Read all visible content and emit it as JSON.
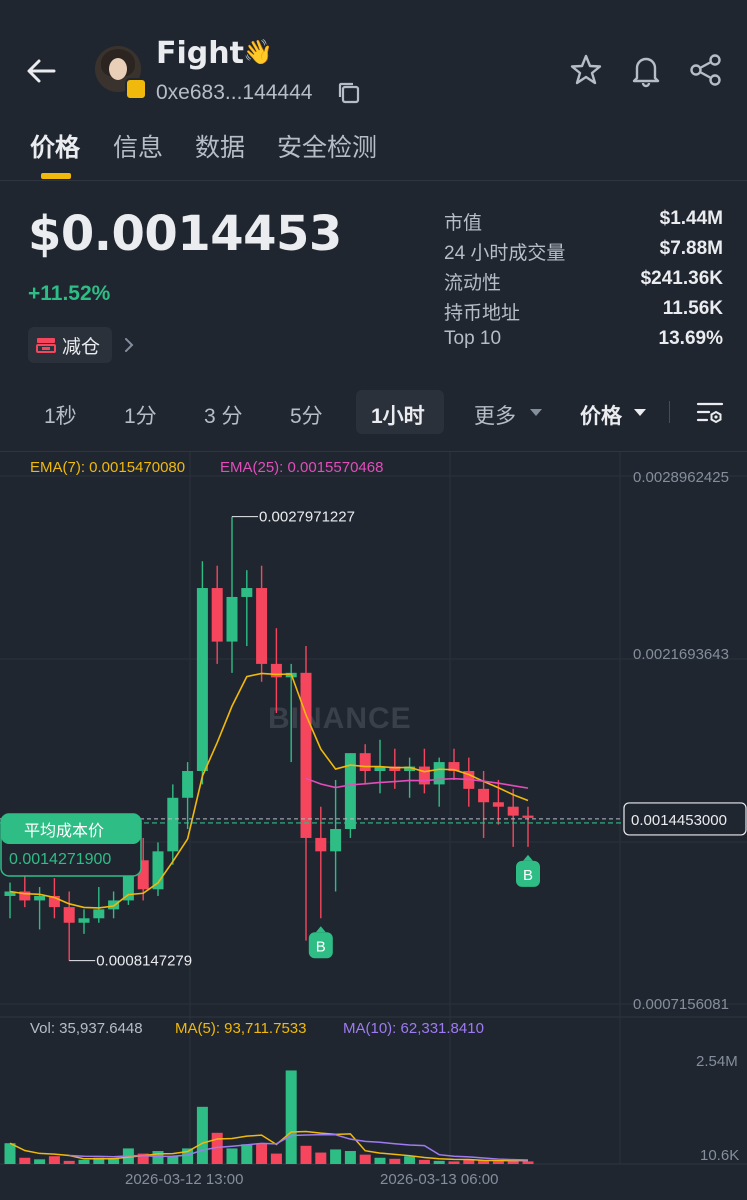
{
  "header": {
    "token_name": "Fight",
    "token_emoji": "👋",
    "address": "0xe683...144444"
  },
  "tabs": [
    {
      "label": "价格",
      "active": true
    },
    {
      "label": "信息",
      "active": false
    },
    {
      "label": "数据",
      "active": false
    },
    {
      "label": "安全检测",
      "active": false
    }
  ],
  "price": {
    "value": "$0.0014453",
    "change": "+11.52%",
    "reduce_label": "减仓"
  },
  "stats": [
    {
      "label": "市值",
      "value": "$1.44M"
    },
    {
      "label": "24 小时成交量",
      "value": "$7.88M"
    },
    {
      "label": "流动性",
      "value": "$241.36K"
    },
    {
      "label": "持币地址",
      "value": "11.56K"
    },
    {
      "label": "Top 10",
      "value": "13.69%"
    }
  ],
  "intervals": [
    {
      "label": "1秒",
      "active": false
    },
    {
      "label": "1分",
      "active": false
    },
    {
      "label": "3 分",
      "active": false
    },
    {
      "label": "5分",
      "active": false
    },
    {
      "label": "1小时",
      "active": true
    },
    {
      "label": "更多",
      "active": false
    }
  ],
  "price_selector": "价格",
  "indicators": {
    "ema7": "EMA(7): 0.0015470080",
    "ema25": "EMA(25): 0.0015570468",
    "vol": "Vol: 35,937.6448",
    "ma5": "MA(5): 93,711.7533",
    "ma10": "MA(10): 62,331.8410"
  },
  "colors": {
    "up": "#2ebd85",
    "down": "#f6465d",
    "ema7": "#f0b90b",
    "ema25": "#e24dba",
    "ma10": "#9d7bf0",
    "accent": "#f0b90b"
  },
  "chart_data": {
    "type": "candlestick",
    "price_axis_labels": [
      "0.0028962425",
      "0.0021693643",
      "0.0014453000",
      "0.0007156081"
    ],
    "volume_axis_labels": [
      "2.54M",
      "10.6K"
    ],
    "x_labels": [
      "2026-03-12 13:00",
      "2026-03-13 06:00"
    ],
    "high_annotation": "0.0027971227",
    "low_annotation": "0.0008147279",
    "current_price_label": "0.0014453000",
    "avg_cost_title": "平均成本价",
    "avg_cost_value": "0.0014271900",
    "avg_cost": 0.00142719,
    "current_price": 0.0014453,
    "watermark": "BINANCE",
    "buy_markers": [
      "B",
      "B"
    ],
    "buy_marker_indices": [
      21,
      35
    ],
    "y_range": [
      0.00058,
      0.003
    ],
    "volume_range": [
      0,
      2540000
    ],
    "candles": [
      {
        "o": 0.0011,
        "h": 0.00116,
        "l": 0.001,
        "c": 0.00112
      },
      {
        "o": 0.00112,
        "h": 0.00122,
        "l": 0.00105,
        "c": 0.00108
      },
      {
        "o": 0.00108,
        "h": 0.00114,
        "l": 0.00095,
        "c": 0.0011
      },
      {
        "o": 0.0011,
        "h": 0.00118,
        "l": 0.001,
        "c": 0.00105
      },
      {
        "o": 0.00105,
        "h": 0.00112,
        "l": 0.00081,
        "c": 0.00098
      },
      {
        "o": 0.00098,
        "h": 0.00104,
        "l": 0.00093,
        "c": 0.001
      },
      {
        "o": 0.001,
        "h": 0.00114,
        "l": 0.00098,
        "c": 0.00104
      },
      {
        "o": 0.00104,
        "h": 0.00112,
        "l": 0.001,
        "c": 0.00108
      },
      {
        "o": 0.00108,
        "h": 0.00128,
        "l": 0.00106,
        "c": 0.00126
      },
      {
        "o": 0.00126,
        "h": 0.00136,
        "l": 0.00108,
        "c": 0.00113
      },
      {
        "o": 0.00113,
        "h": 0.00134,
        "l": 0.0011,
        "c": 0.0013
      },
      {
        "o": 0.0013,
        "h": 0.0016,
        "l": 0.00124,
        "c": 0.00154
      },
      {
        "o": 0.00154,
        "h": 0.0017,
        "l": 0.0014,
        "c": 0.00166
      },
      {
        "o": 0.00166,
        "h": 0.0026,
        "l": 0.0016,
        "c": 0.00248
      },
      {
        "o": 0.00248,
        "h": 0.00258,
        "l": 0.00214,
        "c": 0.00224
      },
      {
        "o": 0.00224,
        "h": 0.0028,
        "l": 0.0021,
        "c": 0.00244
      },
      {
        "o": 0.00244,
        "h": 0.00256,
        "l": 0.00222,
        "c": 0.00248
      },
      {
        "o": 0.00248,
        "h": 0.00258,
        "l": 0.00206,
        "c": 0.00214
      },
      {
        "o": 0.00214,
        "h": 0.0023,
        "l": 0.00192,
        "c": 0.00208
      },
      {
        "o": 0.00208,
        "h": 0.00214,
        "l": 0.0017,
        "c": 0.0021
      },
      {
        "o": 0.0021,
        "h": 0.00222,
        "l": 0.0009,
        "c": 0.00136
      },
      {
        "o": 0.00136,
        "h": 0.0015,
        "l": 0.001,
        "c": 0.0013
      },
      {
        "o": 0.0013,
        "h": 0.00162,
        "l": 0.00112,
        "c": 0.0014
      },
      {
        "o": 0.0014,
        "h": 0.00174,
        "l": 0.00136,
        "c": 0.00174
      },
      {
        "o": 0.00174,
        "h": 0.00178,
        "l": 0.0016,
        "c": 0.00166
      },
      {
        "o": 0.00166,
        "h": 0.0018,
        "l": 0.00156,
        "c": 0.00168
      },
      {
        "o": 0.00168,
        "h": 0.00176,
        "l": 0.00158,
        "c": 0.00166
      },
      {
        "o": 0.00166,
        "h": 0.00172,
        "l": 0.00154,
        "c": 0.00168
      },
      {
        "o": 0.00168,
        "h": 0.00176,
        "l": 0.00156,
        "c": 0.0016
      },
      {
        "o": 0.0016,
        "h": 0.00172,
        "l": 0.0015,
        "c": 0.0017
      },
      {
        "o": 0.0017,
        "h": 0.00176,
        "l": 0.00162,
        "c": 0.00166
      },
      {
        "o": 0.00166,
        "h": 0.00172,
        "l": 0.0015,
        "c": 0.00158
      },
      {
        "o": 0.00158,
        "h": 0.00166,
        "l": 0.00136,
        "c": 0.00152
      },
      {
        "o": 0.00152,
        "h": 0.00162,
        "l": 0.00142,
        "c": 0.0015
      },
      {
        "o": 0.0015,
        "h": 0.00158,
        "l": 0.00132,
        "c": 0.00146
      },
      {
        "o": 0.00146,
        "h": 0.0015,
        "l": 0.00132,
        "c": 0.00145
      }
    ],
    "volumes": [
      400000,
      120000,
      90000,
      150000,
      60000,
      80000,
      120000,
      100000,
      300000,
      200000,
      250000,
      150000,
      300000,
      1100000,
      600000,
      300000,
      380000,
      400000,
      200000,
      1800000,
      350000,
      220000,
      280000,
      250000,
      180000,
      120000,
      100000,
      150000,
      80000,
      60000,
      50000,
      90000,
      70000,
      50000,
      60000,
      50000
    ],
    "volume_colors": [
      "up",
      "down",
      "up",
      "down",
      "down",
      "up",
      "up",
      "up",
      "up",
      "down",
      "up",
      "up",
      "up",
      "up",
      "down",
      "up",
      "up",
      "down",
      "down",
      "up",
      "down",
      "down",
      "up",
      "up",
      "down",
      "up",
      "down",
      "up",
      "down",
      "up",
      "down",
      "down",
      "down",
      "down",
      "down",
      "down"
    ]
  }
}
